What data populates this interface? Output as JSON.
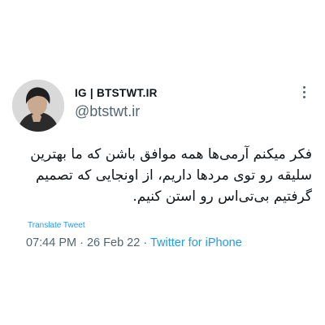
{
  "tweet": {
    "display_name": "IG | BTSTWT.IR",
    "handle": "@btstwt.ir",
    "text": "فکر میکنم آرمی‌ها همه موافق باشن که ما بهترین سلیقه رو توی مردها داریم، از اونجایی که تصمیم گرفتیم بی‌تی‌اس رو استن کنیم.",
    "translate_label": "Translate Tweet",
    "time": "07:44 PM",
    "date": "26 Feb 22",
    "separator": "·",
    "source": "Twitter for iPhone"
  },
  "icons": {
    "more": "more-horizontal-dots-icon",
    "avatar": "profile-avatar"
  },
  "colors": {
    "link": "#1d9bf0",
    "secondary": "#536471",
    "text": "#0f1419"
  }
}
